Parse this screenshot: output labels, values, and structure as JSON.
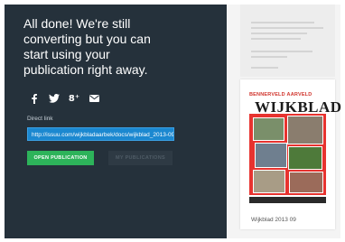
{
  "headline": {
    "lines": [
      "All done! We're still",
      "converting but you can",
      "start using your",
      "publication right away."
    ]
  },
  "share": {
    "icons": [
      "facebook-icon",
      "twitter-icon",
      "google-plus-icon",
      "email-icon"
    ],
    "gplus_text": "8⁺"
  },
  "direct_link": {
    "label": "Direct link",
    "value": "http://issuu.com/wijkbladaarbek/docs/wijkblad_2013-09"
  },
  "buttons": {
    "open": "OPEN PUBLICATION",
    "my_publications": "MY PUBLICATIONS"
  },
  "publication": {
    "caption": "Wijkblad 2013 09",
    "cover_brand_a": "BENNERVELD",
    "cover_brand_b": "AARVELD",
    "cover_title": "WIJKBLAD"
  },
  "colors": {
    "panel": "#25313b",
    "link_field": "#1b88d0",
    "open_button": "#2db35a",
    "cover_red": "#e7332f"
  }
}
